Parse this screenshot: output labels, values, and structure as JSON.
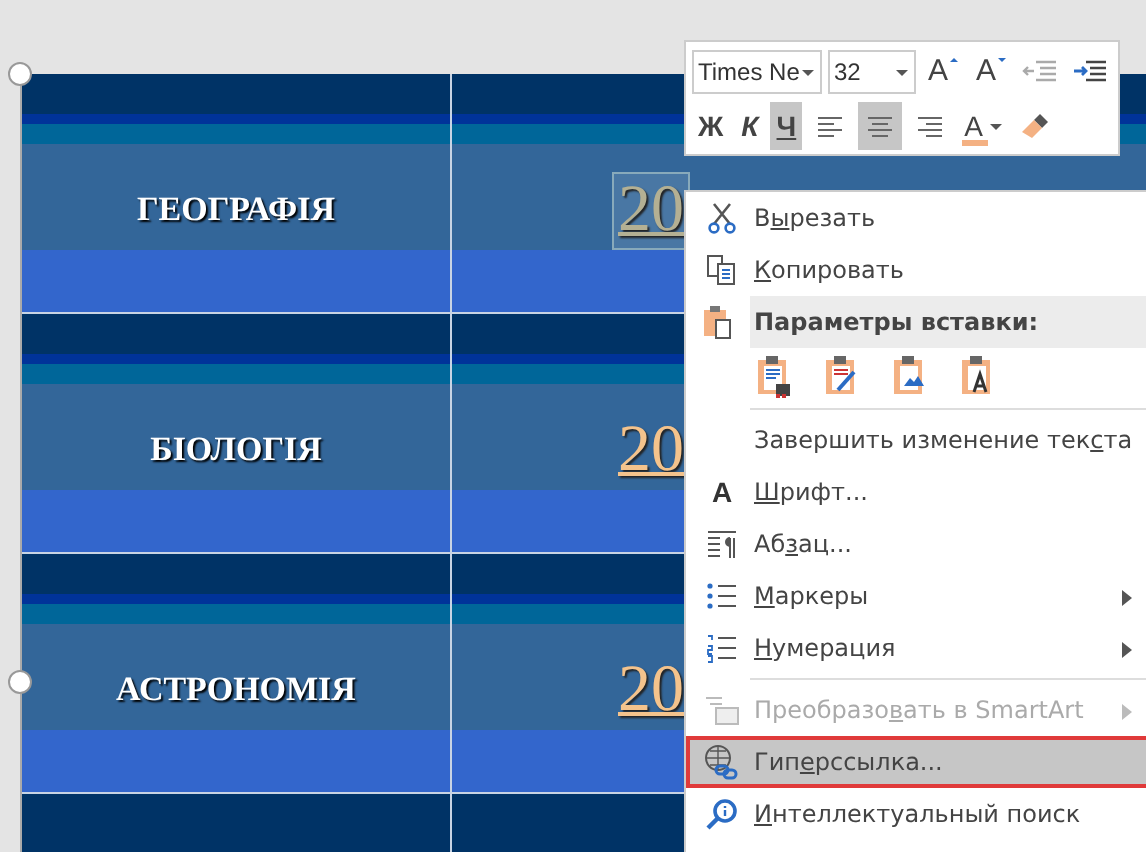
{
  "table": {
    "rows": [
      {
        "subject": "ГЕОГРАФІЯ",
        "value": "20",
        "selected": true
      },
      {
        "subject": "БІОЛОГІЯ",
        "value": "20",
        "selected": false
      },
      {
        "subject": "АСТРОНОМІЯ",
        "value": "20",
        "selected": false
      }
    ]
  },
  "mini_toolbar": {
    "font": "Times Ne",
    "size": "32",
    "row_1": [
      {
        "kind": "grow",
        "text": "A"
      },
      {
        "kind": "shrink",
        "text": "A"
      },
      {
        "kind": "outdent"
      },
      {
        "kind": "indent"
      }
    ],
    "row_2": [
      {
        "kind": "bold",
        "text": "Ж",
        "selected": false
      },
      {
        "kind": "italic",
        "text": "К",
        "selected": false
      },
      {
        "kind": "underline",
        "text": "Ч",
        "selected": true
      },
      {
        "kind": "align-left",
        "selected": false
      },
      {
        "kind": "align-center",
        "selected": true
      },
      {
        "kind": "align-right",
        "selected": false
      },
      {
        "kind": "font-color",
        "text": "A",
        "color": "#f4b183"
      },
      {
        "kind": "painter"
      }
    ]
  },
  "context_menu": {
    "items": [
      {
        "kind": "command",
        "label": {
          "before": "В",
          "key": "ы",
          "after": "резать"
        },
        "disabled": false,
        "submenu": false,
        "selected": false
      },
      {
        "kind": "command",
        "label": {
          "key": "К",
          "after": "опировать"
        },
        "disabled": false,
        "submenu": false,
        "selected": false
      },
      {
        "kind": "header",
        "label": {
          "before": "Параметры вставки:"
        }
      },
      {
        "kind": "paste-options"
      },
      {
        "kind": "separator"
      },
      {
        "kind": "command",
        "label": {
          "before": "Завершить изменение тек",
          "key": "с",
          "after": "та"
        },
        "disabled": false,
        "submenu": false,
        "selected": false
      },
      {
        "kind": "command",
        "icon_text": "A",
        "label": {
          "key": "Ш",
          "after": "рифт..."
        },
        "disabled": false,
        "submenu": false,
        "selected": false
      },
      {
        "kind": "command",
        "label": {
          "before": "Аб",
          "key": "з",
          "after": "ац..."
        },
        "disabled": false,
        "submenu": false,
        "selected": false
      },
      {
        "kind": "command",
        "label": {
          "key": "М",
          "after": "аркеры"
        },
        "disabled": false,
        "submenu": true,
        "selected": false
      },
      {
        "kind": "command",
        "label": {
          "key": "Н",
          "after": "умерация"
        },
        "disabled": false,
        "submenu": true,
        "selected": false
      },
      {
        "kind": "separator"
      },
      {
        "kind": "command",
        "label": {
          "before": "Преобразо",
          "key": "в",
          "after": "ать в SmartArt"
        },
        "disabled": true,
        "submenu": true,
        "selected": false
      },
      {
        "kind": "command",
        "label": {
          "before": "Гип",
          "key": "е",
          "after": "рссылка..."
        },
        "disabled": false,
        "submenu": false,
        "selected": true
      },
      {
        "kind": "command",
        "label": {
          "key": "И",
          "after": "нтеллектуальный поиск"
        },
        "disabled": false,
        "submenu": false,
        "selected": false
      }
    ]
  }
}
